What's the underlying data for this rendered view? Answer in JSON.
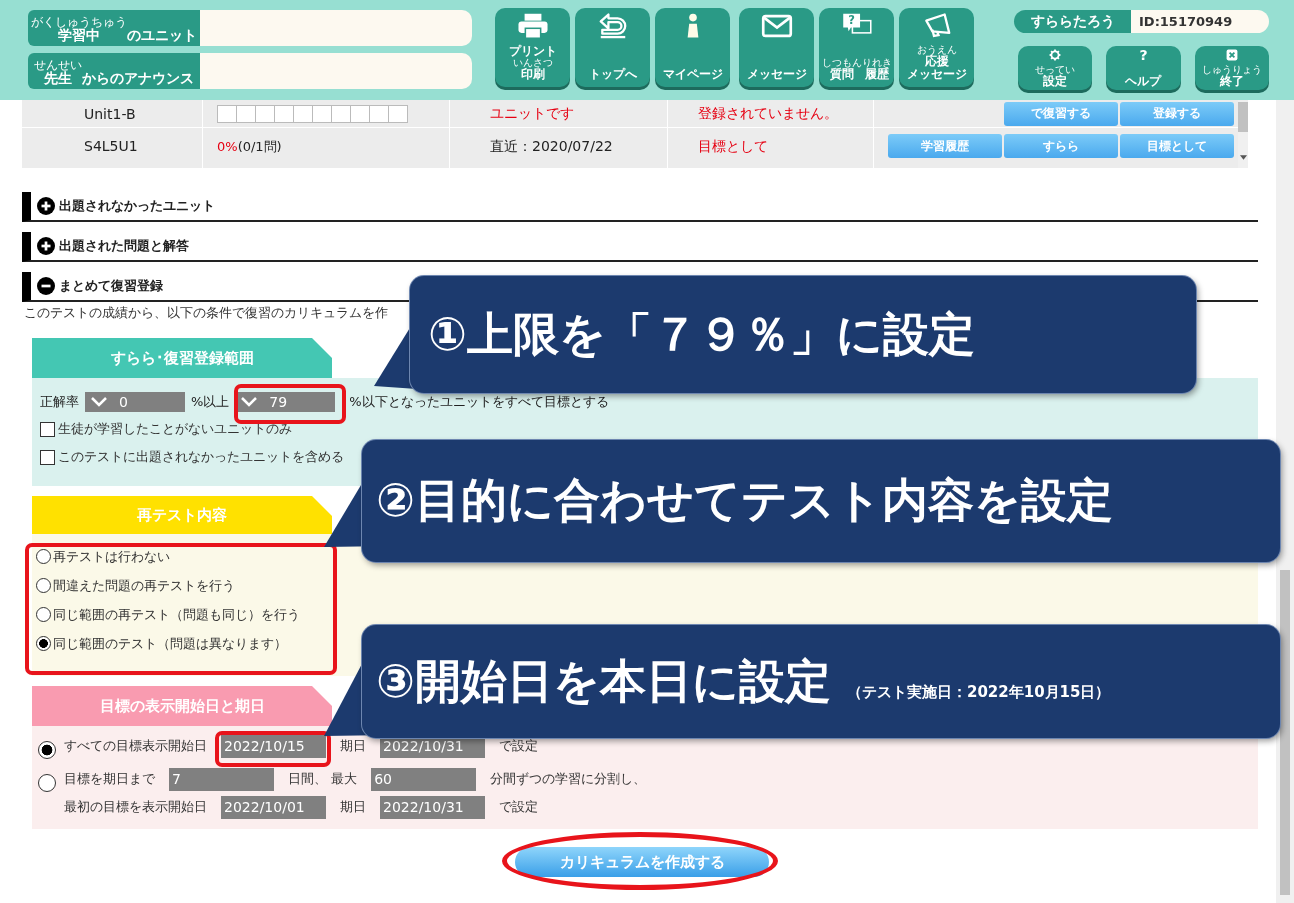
{
  "header": {
    "fields": [
      {
        "parts": [
          {
            "text": "学習中",
            "ruby": "がくしゅうちゅう"
          },
          {
            "text": "のユニット"
          }
        ]
      },
      {
        "parts": [
          {
            "text": "先生",
            "ruby": "せんせい"
          },
          {
            "text": "からのアナウンス"
          }
        ]
      }
    ]
  },
  "nav_buttons": [
    {
      "kind": "printer",
      "lines": [
        [
          {
            "text": "プリント"
          }
        ],
        [
          {
            "text": "印刷",
            "ruby": "いんさつ"
          }
        ]
      ]
    },
    {
      "kind": "return",
      "lines": [
        [
          {
            "text": "トップへ"
          }
        ]
      ]
    },
    {
      "kind": "person",
      "lines": [
        [
          {
            "text": "マイページ"
          }
        ]
      ]
    },
    {
      "kind": "envelope",
      "lines": [
        [
          {
            "text": "メッセージ"
          }
        ]
      ]
    },
    {
      "kind": "question-bubbles",
      "glyph": "?",
      "lines": [
        [
          {
            "text": "質問",
            "ruby": "しつもん"
          },
          {
            "text": "履歴",
            "ruby": "りれき"
          }
        ]
      ]
    },
    {
      "kind": "megaphone",
      "lines": [
        [
          {
            "text": "応援",
            "ruby": "おうえん"
          }
        ],
        [
          {
            "text": "メッセージ"
          }
        ]
      ]
    }
  ],
  "user": {
    "name": "すららたろう",
    "id": "ID:15170949"
  },
  "utility_buttons": [
    {
      "kind": "gear",
      "parts": [
        {
          "text": "設定",
          "ruby": "せってい"
        }
      ]
    },
    {
      "kind": "help",
      "glyph": "?",
      "parts": [
        {
          "text": "ヘルプ"
        }
      ]
    },
    {
      "kind": "close",
      "parts": [
        {
          "text": "終了",
          "ruby": "しゅうりょう"
        }
      ]
    }
  ],
  "table": {
    "rows": [
      {
        "unit": "Unit1-B",
        "status": "ユニットです",
        "goal": "登録されていません。",
        "buttons": [
          "で復習する",
          "登録する"
        ]
      },
      {
        "unit": "S4L5U1",
        "rate": "0%",
        "count": "(0/1問)",
        "recent": "直近：2020/07/22",
        "goal": "目標として",
        "buttons": [
          "学習履歴",
          "すらら",
          "目標として"
        ]
      }
    ]
  },
  "sections": [
    {
      "title": "出題されなかったユニット",
      "expanded": false
    },
    {
      "title": "出題された問題と解答",
      "expanded": false
    },
    {
      "title": "まとめて復習登録",
      "expanded": true
    }
  ],
  "intro": "このテストの成績から、以下の条件で復習のカリキュラムを作",
  "range": {
    "title": "すらら･復習登録範囲",
    "label": "正解率",
    "lower": "0",
    "lower_suffix": "%以上",
    "upper": "79",
    "upper_suffix": "%以下となったユニットをすべて目標とする",
    "options": [
      {
        "label": "生徒が学習したことがないユニットのみ",
        "checked": false
      },
      {
        "label": "このテストに出題されなかったユニットを含める",
        "checked": false
      }
    ]
  },
  "retest": {
    "title": "再テスト内容",
    "options": [
      {
        "label": "再テストは行わない",
        "selected": false
      },
      {
        "label": "間違えた問題の再テストを行う",
        "selected": false
      },
      {
        "label": "同じ範囲の再テスト（問題も同じ）を行う",
        "selected": false
      },
      {
        "label": "同じ範囲のテスト（問題は異なります）",
        "selected": true
      }
    ]
  },
  "schedule": {
    "title": "目標の表示開始日と期日",
    "modes": [
      {
        "selected": true,
        "lines": [
          [
            {
              "kind": "text",
              "text": "すべての目標表示開始日"
            },
            {
              "kind": "field",
              "value": "2022/10/15"
            },
            {
              "kind": "text",
              "text": "期日"
            },
            {
              "kind": "field",
              "value": "2022/10/31"
            },
            {
              "kind": "text",
              "text": "で設定"
            }
          ]
        ]
      },
      {
        "selected": false,
        "lines": [
          [
            {
              "kind": "text",
              "text": "目標を期日まで"
            },
            {
              "kind": "field",
              "value": "7"
            },
            {
              "kind": "text",
              "text": "日間、 最大"
            },
            {
              "kind": "field",
              "value": "60"
            },
            {
              "kind": "text",
              "text": "分間ずつの学習に分割し、"
            }
          ],
          [
            {
              "kind": "text",
              "text": "最初の目標を表示開始日"
            },
            {
              "kind": "field",
              "value": "2022/10/01"
            },
            {
              "kind": "text",
              "text": "期日"
            },
            {
              "kind": "field",
              "value": "2022/10/31"
            },
            {
              "kind": "text",
              "text": "で設定"
            }
          ]
        ]
      }
    ]
  },
  "create_button": "カリキュラムを作成する",
  "callouts": [
    {
      "text": "①上限を「７９％」に設定"
    },
    {
      "text": "②目的に合わせてテスト内容を設定"
    },
    {
      "text": "③開始日を本日に設定",
      "note": "（テスト実施日：2022年10月15日）"
    }
  ]
}
